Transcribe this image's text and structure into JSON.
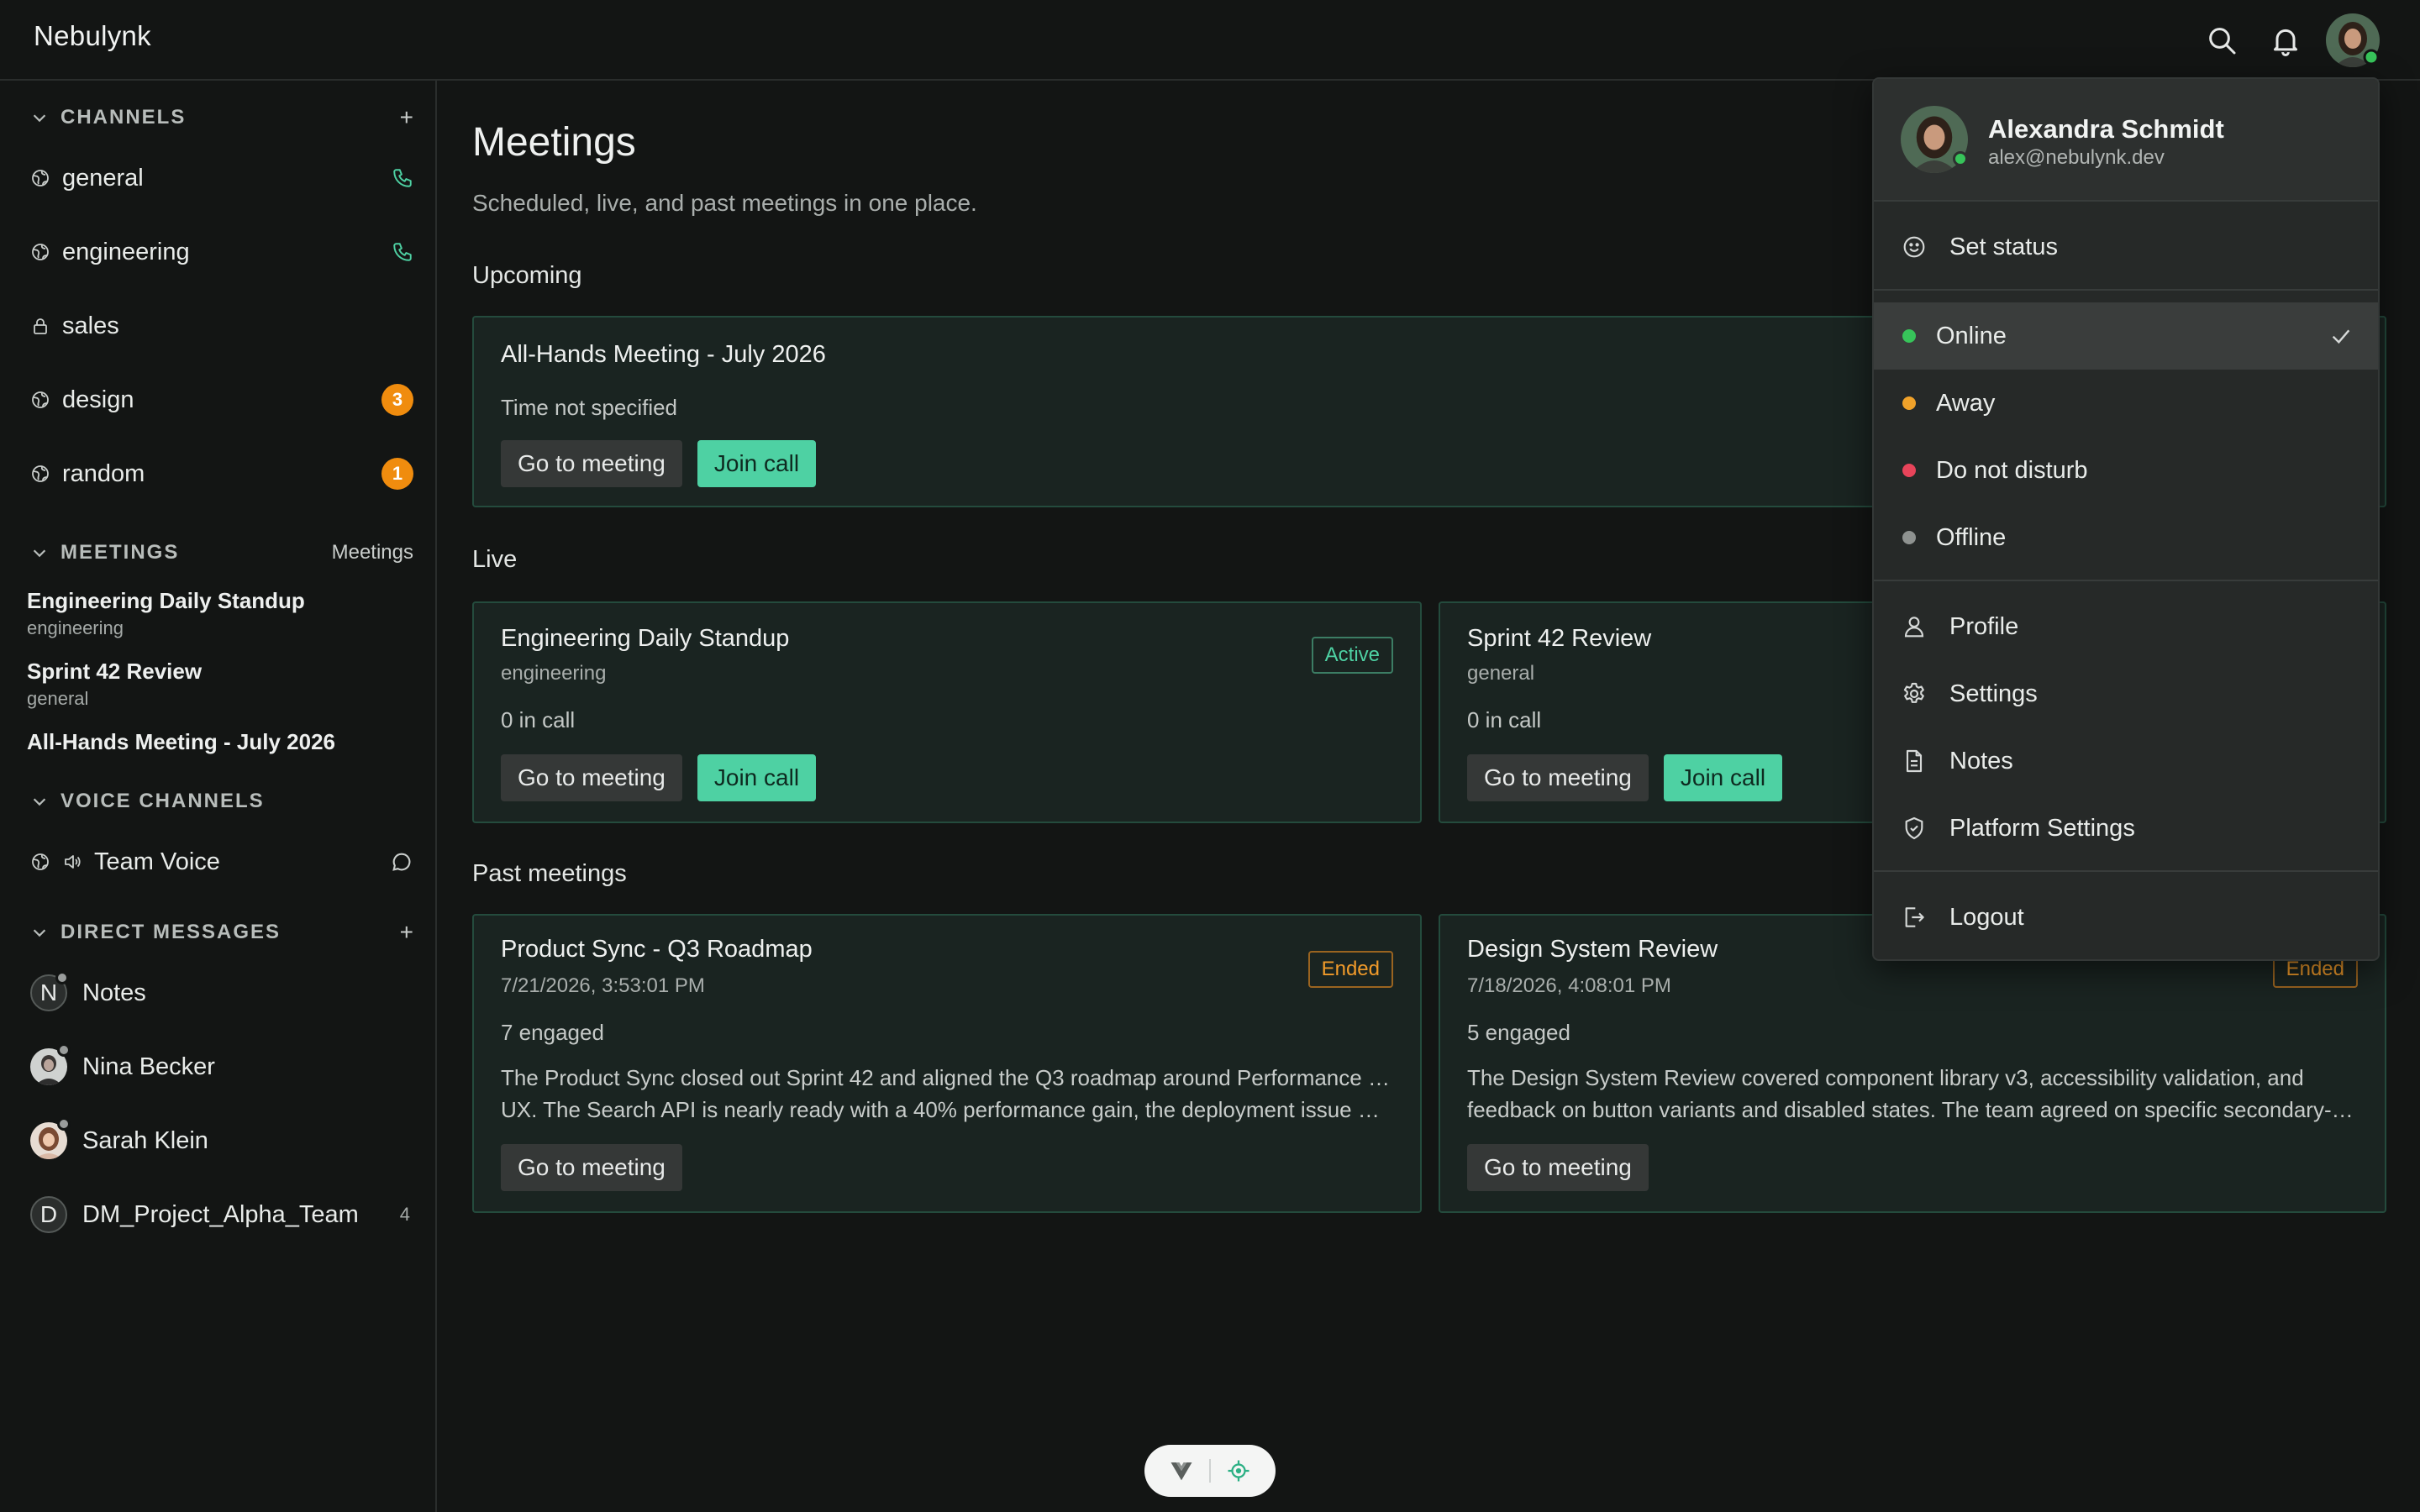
{
  "app": {
    "name": "Nebulynk"
  },
  "topbar": {
    "icons": [
      "search-icon",
      "bell-icon"
    ]
  },
  "sidebar": {
    "channels": {
      "title": "CHANNELS",
      "add": "+",
      "items": [
        {
          "label": "general",
          "icon": "globe-icon",
          "trailing": "phone-icon"
        },
        {
          "label": "engineering",
          "icon": "globe-icon",
          "trailing": "phone-icon"
        },
        {
          "label": "sales",
          "icon": "lock-icon"
        },
        {
          "label": "design",
          "icon": "globe-icon",
          "badge": "3"
        },
        {
          "label": "random",
          "icon": "globe-icon",
          "badge": "1"
        }
      ]
    },
    "meetings": {
      "title": "MEETINGS",
      "link": "Meetings",
      "items": [
        {
          "title": "Engineering Daily Standup",
          "channel": "engineering"
        },
        {
          "title": "Sprint 42 Review",
          "channel": "general"
        },
        {
          "title": "All-Hands Meeting - July 2026"
        }
      ]
    },
    "voice": {
      "title": "VOICE CHANNELS",
      "items": [
        {
          "label": "Team Voice"
        }
      ]
    },
    "dms": {
      "title": "DIRECT MESSAGES",
      "add": "+",
      "items": [
        {
          "label": "Notes",
          "initial": "N"
        },
        {
          "label": "Nina Becker"
        },
        {
          "label": "Sarah Klein"
        },
        {
          "label": "DM_Project_Alpha_Team",
          "initial": "D",
          "count": "4"
        }
      ]
    }
  },
  "main": {
    "title": "Meetings",
    "subtitle": "Scheduled, live, and past meetings in one place.",
    "upcoming": {
      "heading": "Upcoming",
      "cards": [
        {
          "title": "All-Hands Meeting - July 2026",
          "meta": "Time not specified",
          "go": "Go to meeting",
          "join": "Join call"
        }
      ]
    },
    "live": {
      "heading": "Live",
      "cards": [
        {
          "title": "Engineering Daily Standup",
          "channel": "engineering",
          "tag": "Active",
          "meta": "0 in call",
          "go": "Go to meeting",
          "join": "Join call"
        },
        {
          "title": "Sprint 42 Review",
          "channel": "general",
          "meta": "0 in call",
          "go": "Go to meeting",
          "join": "Join call"
        }
      ]
    },
    "past": {
      "heading": "Past meetings",
      "cards": [
        {
          "title": "Product Sync - Q3 Roadmap",
          "date": "7/21/2026, 3:53:01 PM",
          "tag": "Ended",
          "meta": "7 engaged",
          "desc1": "The Product Sync closed out Sprint 42 and aligned the Q3 roadmap around Performance and",
          "desc2": "UX. The Search API is nearly ready with a 40% performance gain, the deployment issue has…",
          "go": "Go to meeting"
        },
        {
          "title": "Design System Review",
          "date": "7/18/2026, 4:08:01 PM",
          "tag": "Ended",
          "meta": "5 engaged",
          "desc1": "The Design System Review covered component library v3, accessibility validation, and",
          "desc2": "feedback on button variants and disabled states. The team agreed on specific secondary-…",
          "go": "Go to meeting"
        }
      ]
    }
  },
  "user_menu": {
    "name": "Alexandra Schmidt",
    "email": "alex@nebulynk.dev",
    "set_status": "Set status",
    "statuses": [
      {
        "label": "Online",
        "color": "#37c45a",
        "selected": true
      },
      {
        "label": "Away",
        "color": "#f0a22a"
      },
      {
        "label": "Do not disturb",
        "color": "#e8445a"
      },
      {
        "label": "Offline",
        "color": "#8e9290"
      }
    ],
    "items": [
      {
        "label": "Profile",
        "icon": "user-icon"
      },
      {
        "label": "Settings",
        "icon": "gear-icon"
      },
      {
        "label": "Notes",
        "icon": "document-icon"
      },
      {
        "label": "Platform Settings",
        "icon": "shield-icon"
      }
    ],
    "logout": "Logout"
  },
  "colors": {
    "accent": "#4ed1a3",
    "badge": "#f08c0e",
    "ended": "#f09a2a"
  }
}
